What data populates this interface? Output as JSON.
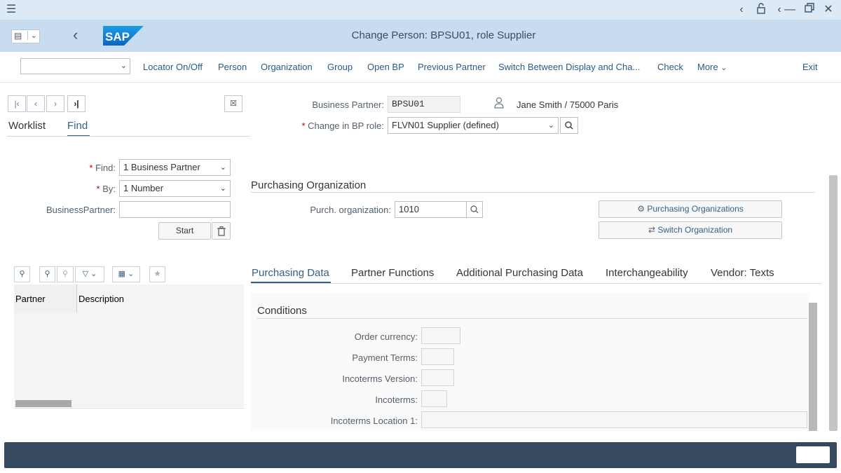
{
  "window": {
    "title": "Change Person: BPSU01, role Supplier",
    "logo_text": "SAP"
  },
  "toolbar": {
    "select_value": "",
    "items": [
      "Locator On/Off",
      "Person",
      "Organization",
      "Group",
      "Open BP",
      "Previous Partner",
      "Switch Between Display and Cha...",
      "Check",
      "More",
      "Exit"
    ]
  },
  "locator": {
    "tabs": [
      "Worklist",
      "Find"
    ],
    "active_tab": "Find",
    "find_label": "Find:",
    "find_value": "1 Business Partner",
    "by_label": "By:",
    "by_value": "1 Number",
    "bp_label": "BusinessPartner:",
    "bp_value": "",
    "start_label": "Start",
    "columns": [
      "Partner",
      "Description"
    ]
  },
  "header": {
    "bp_label": "Business Partner:",
    "bp_value": "BPSU01",
    "bp_name": "Jane Smith / 75000 Paris",
    "role_label": "Change in BP role:",
    "role_value": "FLVN01 Supplier (defined)"
  },
  "purchasing": {
    "section_title": "Purchasing Organization",
    "org_label": "Purch. organization:",
    "org_value": "1010",
    "btn_orgs": "Purchasing Organizations",
    "btn_switch": "Switch Organization"
  },
  "tabs": [
    "Purchasing Data",
    "Partner Functions",
    "Additional Purchasing Data",
    "Interchangeability",
    "Vendor: Texts"
  ],
  "conditions": {
    "title": "Conditions",
    "fields": [
      {
        "label": "Order currency:",
        "value": ""
      },
      {
        "label": "Payment Terms:",
        "value": ""
      },
      {
        "label": "Incoterms Version:",
        "value": ""
      },
      {
        "label": "Incoterms:",
        "value": ""
      },
      {
        "label": "Incoterms Location 1:",
        "value": ""
      }
    ]
  },
  "colors": {
    "title_bar": "#c8dcef",
    "link": "#2a5a8a",
    "footer": "#354a5f"
  }
}
